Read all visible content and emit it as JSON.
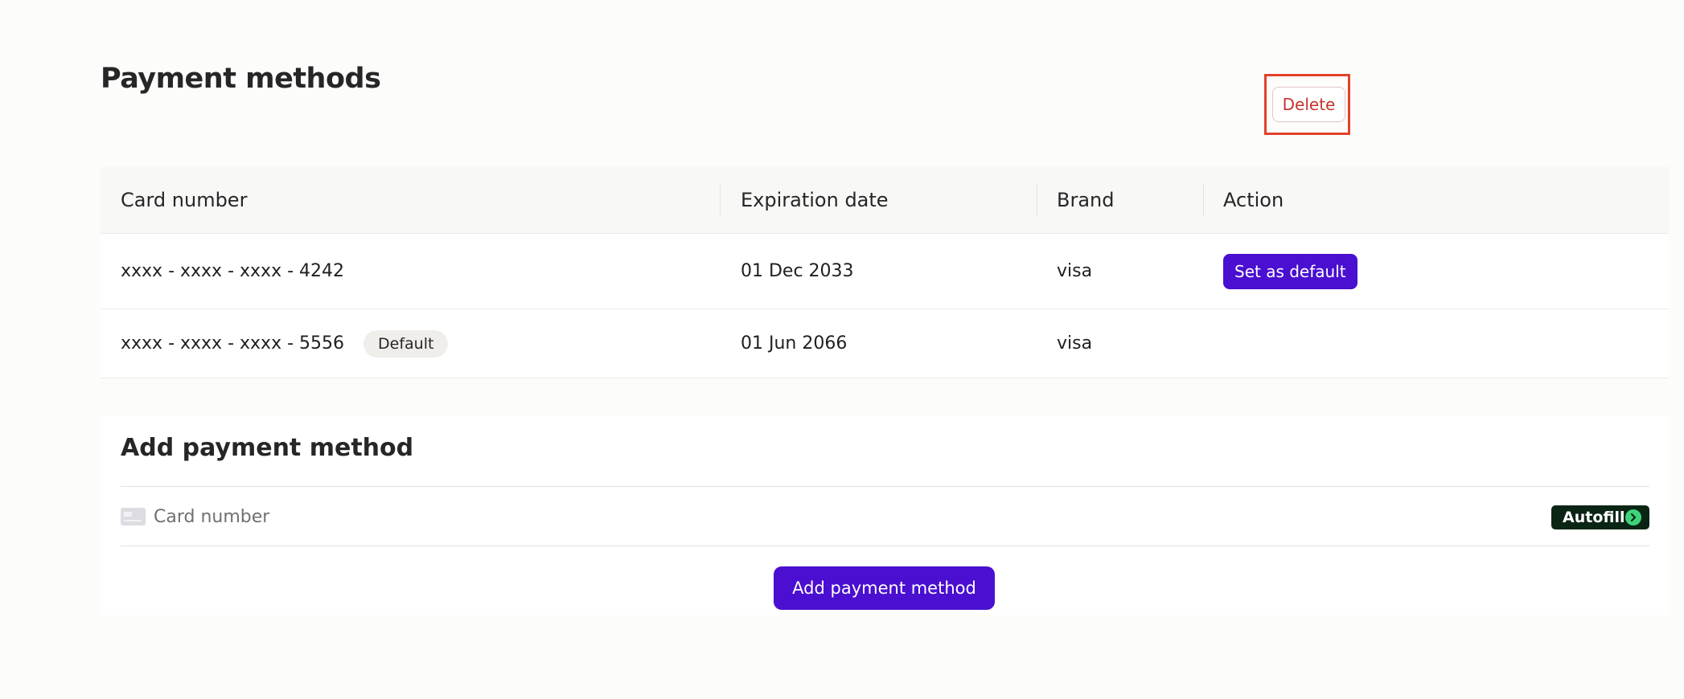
{
  "page_title": "Payment methods",
  "table": {
    "headers": [
      "Card number",
      "Expiration date",
      "Brand",
      "Action"
    ],
    "rows": [
      {
        "card_number": "xxxx - xxxx - xxxx - 4242",
        "expiration": "01 Dec 2033",
        "brand": "visa",
        "set_default_label": "Set as default",
        "delete_label": "Delete"
      },
      {
        "card_number": "xxxx - xxxx - xxxx - 5556",
        "badge": "Default",
        "expiration": "01 Jun 2066",
        "brand": "visa"
      }
    ]
  },
  "add_form": {
    "title": "Add payment method",
    "card_placeholder": "Card number",
    "autofill_label": "Autofill",
    "submit_label": "Add payment method"
  },
  "colors": {
    "accent": "#4a0fd0",
    "delete_text": "#c8332e",
    "highlight_border": "#e2412a",
    "autofill_bg": "#0b2515",
    "autofill_icon": "#3ed37a"
  },
  "icons": [
    "card-icon",
    "chevron-right-icon"
  ]
}
